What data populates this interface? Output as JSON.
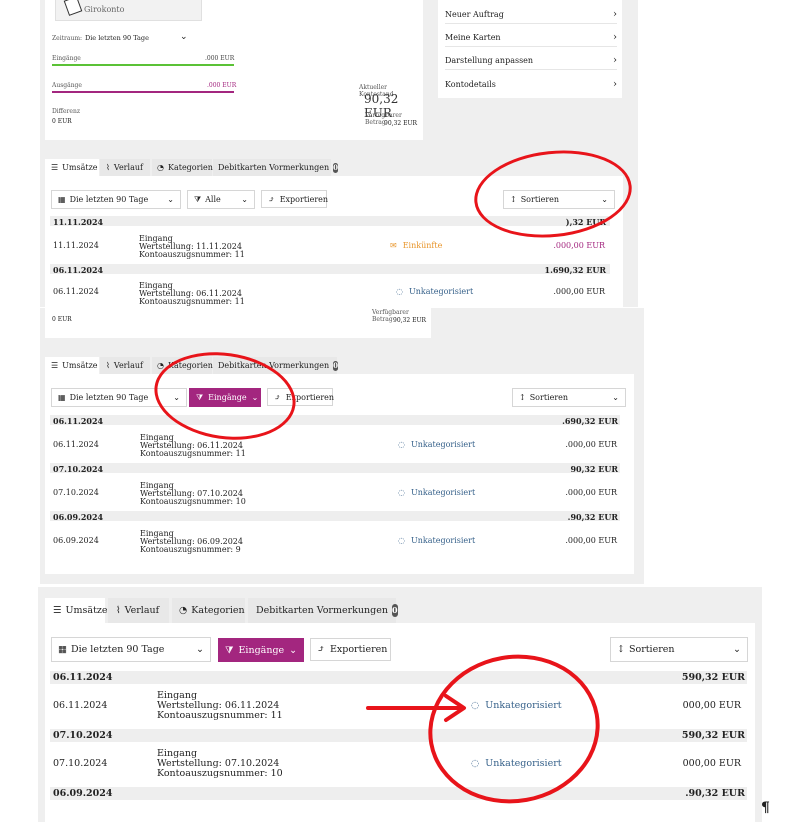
{
  "top_panel": {
    "account_name": "Girokonto",
    "period_label": "Zeitraum:",
    "period_value": "Die letzten 90 Tage",
    "income_label": "Eingänge",
    "income_value": ".000 EUR",
    "expense_label": "Ausgänge",
    "expense_value": ".000 EUR",
    "difference_label": "Differenz",
    "difference_value": "0 EUR",
    "balance_label": "Aktueller Kontostand",
    "balance_value": "90,32 EUR",
    "available_label": "Verfügbarer Betrag",
    "available_value": "90,32 EUR",
    "menu": [
      {
        "label": "Neuer Auftrag"
      },
      {
        "label": "Meine Karten"
      },
      {
        "label": "Darstellung anpassen"
      },
      {
        "label": "Kontodetails"
      }
    ]
  },
  "tabs": {
    "sales": "Umsätze",
    "history": "Verlauf",
    "categories": "Kategorien",
    "debit": "Debitkarten Vormerkungen",
    "debit_count": "0"
  },
  "toolbar": {
    "period": "Die letzten 90 Tage",
    "filter_all": "Alle",
    "filter_income": "Eingänge",
    "export": "Exportieren",
    "sort": "Sortieren"
  },
  "panel1": {
    "groups": [
      {
        "date": "11.11.2024",
        "total": "),32 EUR",
        "row": {
          "date": "11.11.2024",
          "l1": "Eingang",
          "l2": "Wertstellung: 11.11.2024",
          "l3": "Kontoauszugsnummer: 11",
          "category": "Einkünfte",
          "amount": ".000,00 EUR"
        }
      },
      {
        "date": "06.11.2024",
        "total": "1.690,32 EUR",
        "row": {
          "date": "06.11.2024",
          "l1": "Eingang",
          "l2": "Wertstellung: 06.11.2024",
          "l3": "Kontoauszugsnummer: 11",
          "category": "Unkategorisiert",
          "amount": ".000,00 EUR"
        }
      }
    ]
  },
  "panel2_head": {
    "difference_value": "0 EUR",
    "available_label": "Verfügbarer Betrag",
    "available_value": "90,32 EUR"
  },
  "panel2": {
    "groups": [
      {
        "date": "06.11.2024",
        "total": ".690,32 EUR",
        "row": {
          "date": "06.11.2024",
          "l1": "Eingang",
          "l2": "Wertstellung: 06.11.2024",
          "l3": "Kontoauszugsnummer: 11",
          "category": "Unkategorisiert",
          "amount": ".000,00 EUR"
        }
      },
      {
        "date": "07.10.2024",
        "total": "90,32 EUR",
        "row": {
          "date": "07.10.2024",
          "l1": "Eingang",
          "l2": "Wertstellung: 07.10.2024",
          "l3": "Kontoauszugsnummer: 10",
          "category": "Unkategorisiert",
          "amount": ".000,00 EUR"
        }
      },
      {
        "date": "06.09.2024",
        "total": ".90,32 EUR",
        "row": {
          "date": "06.09.2024",
          "l1": "Eingang",
          "l2": "Wertstellung: 06.09.2024",
          "l3": "Kontoauszugsnummer: 9",
          "category": "Unkategorisiert",
          "amount": ".000,00 EUR"
        }
      }
    ]
  },
  "panel3": {
    "groups": [
      {
        "date": "06.11.2024",
        "total": "590,32 EUR",
        "row": {
          "date": "06.11.2024",
          "l1": "Eingang",
          "l2": "Wertstellung: 06.11.2024",
          "l3": "Kontoauszugsnummer: 11",
          "category": "Unkategorisiert",
          "amount": "000,00 EUR"
        }
      },
      {
        "date": "07.10.2024",
        "total": "590,32 EUR",
        "row": {
          "date": "07.10.2024",
          "l1": "Eingang",
          "l2": "Wertstellung: 07.10.2024",
          "l3": "Kontoauszugsnummer: 10",
          "category": "Unkategorisiert",
          "amount": "000,00 EUR"
        }
      },
      {
        "date": "06.09.2024",
        "total": ".90,32 EUR"
      }
    ]
  },
  "colors": {
    "accent": "#a3267f",
    "income_bar": "#5bc236",
    "expense_bar": "#a3267f",
    "annotation": "#e8141a",
    "category_orange": "#e8952a"
  }
}
